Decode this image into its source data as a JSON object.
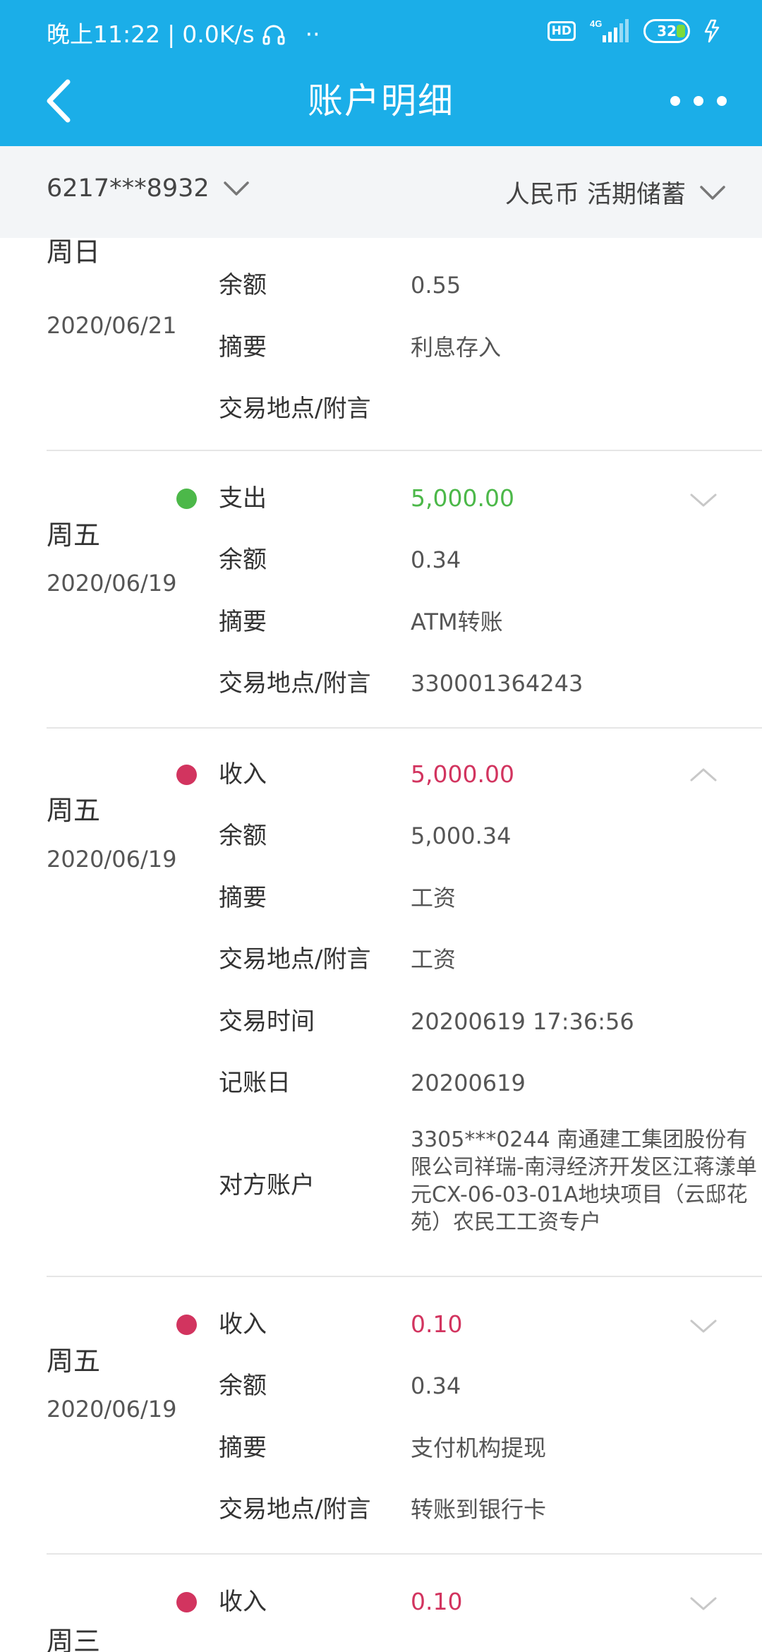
{
  "colors": {
    "brand": "#1BAEE8",
    "expense": "#4CB849",
    "income": "#D2345F"
  },
  "status_bar": {
    "time": "晚上11:22",
    "speed": "0.0K/s",
    "headset_icon": "headset-icon",
    "dots": "··",
    "hd": "HD",
    "network": "4G",
    "battery": "32"
  },
  "nav": {
    "title": "账户明细",
    "back_icon": "chevron-left-icon",
    "more_icon": "more-dots-icon"
  },
  "filter": {
    "account": "6217***8932",
    "currency": "人民币 活期储蓄"
  },
  "records": [
    {
      "weekday": "周日",
      "date": "2020/06/21",
      "rows": [
        {
          "label": "余额",
          "value": "0.55"
        },
        {
          "label": "摘要",
          "value": "利息存入"
        },
        {
          "label": "交易地点/附言",
          "value": ""
        }
      ]
    },
    {
      "weekday": "周五",
      "date": "2020/06/19",
      "type": "支出",
      "amount": "5,000.00",
      "expanded": false,
      "rows": [
        {
          "label": "余额",
          "value": "0.34"
        },
        {
          "label": "摘要",
          "value": "ATM转账"
        },
        {
          "label": "交易地点/附言",
          "value": "330001364243"
        }
      ]
    },
    {
      "weekday": "周五",
      "date": "2020/06/19",
      "type": "收入",
      "amount": "5,000.00",
      "expanded": true,
      "rows": [
        {
          "label": "余额",
          "value": "5,000.34"
        },
        {
          "label": "摘要",
          "value": "工资"
        },
        {
          "label": "交易地点/附言",
          "value": "工资"
        },
        {
          "label": "交易时间",
          "value": "20200619 17:36:56"
        },
        {
          "label": "记账日",
          "value": "20200619"
        },
        {
          "label": "对方账户",
          "value": "3305***0244 南通建工集团股份有限公司祥瑞-南浔经济开发区江蒋漾单元CX-06-03-01A地块项目（云邸花苑）农民工工资专户"
        }
      ]
    },
    {
      "weekday": "周五",
      "date": "2020/06/19",
      "type": "收入",
      "amount": "0.10",
      "expanded": false,
      "rows": [
        {
          "label": "余额",
          "value": "0.34"
        },
        {
          "label": "摘要",
          "value": "支付机构提现"
        },
        {
          "label": "交易地点/附言",
          "value": "转账到银行卡"
        }
      ]
    },
    {
      "weekday": "周三",
      "type": "收入",
      "amount": "0.10",
      "expanded": false
    }
  ]
}
